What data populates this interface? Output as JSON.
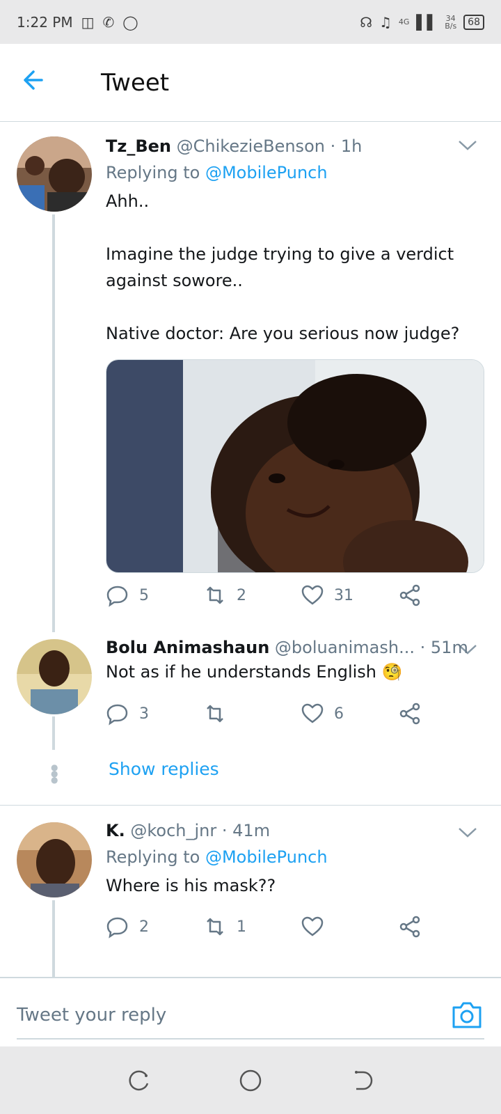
{
  "status_bar": {
    "time": "1:22 PM",
    "network": "4G",
    "speed_value": "34",
    "speed_unit": "B/s",
    "battery": "68"
  },
  "header": {
    "title": "Tweet"
  },
  "tweets": [
    {
      "name": "Tz_Ben",
      "handle": "@ChikezieBenson",
      "time": "· 1h",
      "replying_prefix": "Replying to",
      "replying_to": "@MobilePunch",
      "text": "Ahh..\n\nImagine the judge trying to give a verdict against sowore..\n\nNative doctor: Are you serious now judge?",
      "replies": "5",
      "retweets": "2",
      "likes": "31"
    },
    {
      "name": "Bolu Animashaun",
      "handle": "@boluanimash...",
      "time": "· 51m",
      "text": "Not as if he understands English 🧐",
      "replies": "3",
      "retweets": "",
      "likes": "6"
    },
    {
      "name": "K.",
      "handle": "@koch_jnr",
      "time": "· 41m",
      "replying_prefix": "Replying to",
      "replying_to": "@MobilePunch",
      "text": "Where is his mask??",
      "replies": "2",
      "retweets": "1",
      "likes": ""
    }
  ],
  "show_replies": "Show replies",
  "composer": {
    "placeholder": "Tweet your reply"
  },
  "colors": {
    "accent": "#1da1f2",
    "secondary_text": "#657786",
    "divider": "#cfd9de"
  }
}
